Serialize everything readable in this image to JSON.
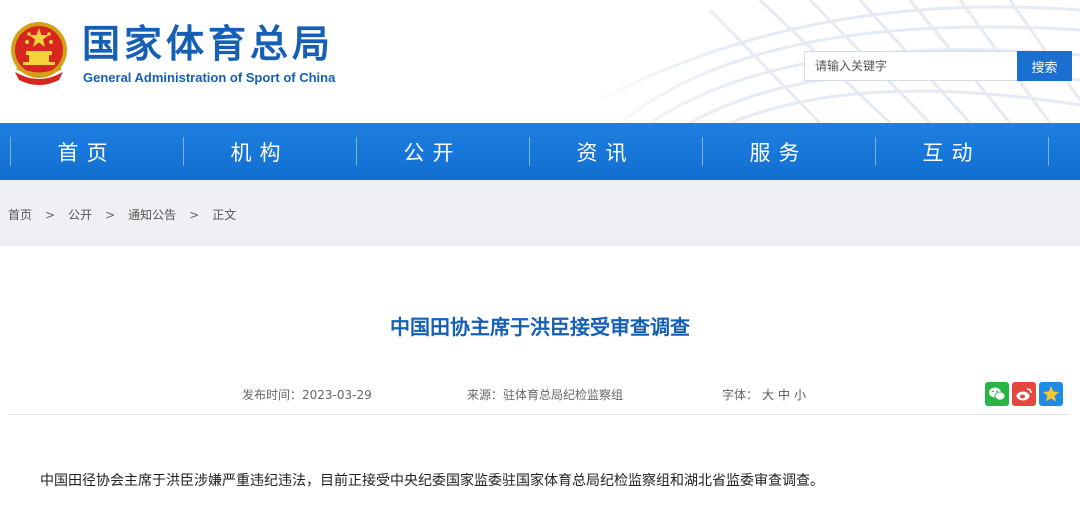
{
  "header": {
    "title": "国家体育总局",
    "subtitle": "General Administration of Sport of China",
    "emblem_icon": "national-emblem-icon"
  },
  "search": {
    "placeholder": "请输入关键字",
    "button_label": "搜索"
  },
  "nav": {
    "items": [
      {
        "label": "首页"
      },
      {
        "label": "机构"
      },
      {
        "label": "公开"
      },
      {
        "label": "资讯"
      },
      {
        "label": "服务"
      },
      {
        "label": "互动"
      }
    ]
  },
  "breadcrumb": {
    "items": [
      "首页",
      "公开",
      "通知公告",
      "正文"
    ],
    "separator": ">"
  },
  "article": {
    "title": "中国田协主席于洪臣接受审查调查",
    "date": "发布时间：2023-03-29",
    "source": "来源：驻体育总局纪检监察组",
    "font_label": "字体：",
    "font_sizes": [
      "大",
      "中",
      "小"
    ],
    "body": "中国田径协会主席于洪臣涉嫌严重违纪违法，目前正接受中央纪委国家监委驻国家体育总局纪检监察组和湖北省监委审查调查。"
  },
  "share": {
    "icons": [
      "wechat-icon",
      "weibo-icon",
      "qzone-icon"
    ]
  },
  "colors": {
    "brand_blue": "#1560b5",
    "nav_blue": "#1a76db",
    "breadcrumb_bg": "#eef0f3"
  }
}
